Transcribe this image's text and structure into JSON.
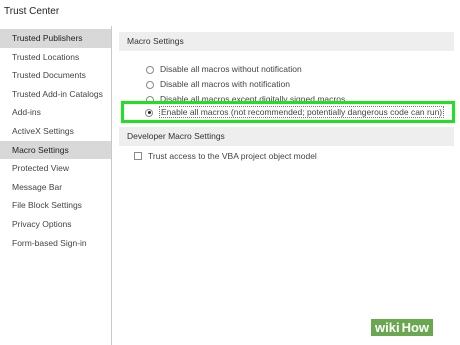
{
  "window": {
    "title": "Trust Center"
  },
  "sidebar": {
    "items": [
      {
        "label": "Trusted Publishers",
        "selected": true
      },
      {
        "label": "Trusted Locations",
        "selected": false
      },
      {
        "label": "Trusted Documents",
        "selected": false
      },
      {
        "label": "Trusted Add-in Catalogs",
        "selected": false
      },
      {
        "label": "Add-ins",
        "selected": false
      },
      {
        "label": "ActiveX Settings",
        "selected": false
      },
      {
        "label": "Macro Settings",
        "selected": true
      },
      {
        "label": "Protected View",
        "selected": false
      },
      {
        "label": "Message Bar",
        "selected": false
      },
      {
        "label": "File Block Settings",
        "selected": false
      },
      {
        "label": "Privacy Options",
        "selected": false
      },
      {
        "label": "Form-based Sign-in",
        "selected": false
      }
    ]
  },
  "macro_settings": {
    "header": "Macro Settings",
    "options": [
      {
        "label": "Disable all macros without notification",
        "checked": false
      },
      {
        "label": "Disable all macros with notification",
        "checked": false
      },
      {
        "label": "Disable all macros except digitally signed macros",
        "checked": false
      },
      {
        "label": "Enable all macros (not recommended; potentially dangerous code can run)",
        "checked": true
      }
    ],
    "highlight_color": "#21e021"
  },
  "developer_macro_settings": {
    "header": "Developer Macro Settings",
    "trust_vba_label": "Trust access to the VBA project object model",
    "trust_vba_checked": false
  },
  "watermark": {
    "wiki": "wiki",
    "how": "How"
  }
}
